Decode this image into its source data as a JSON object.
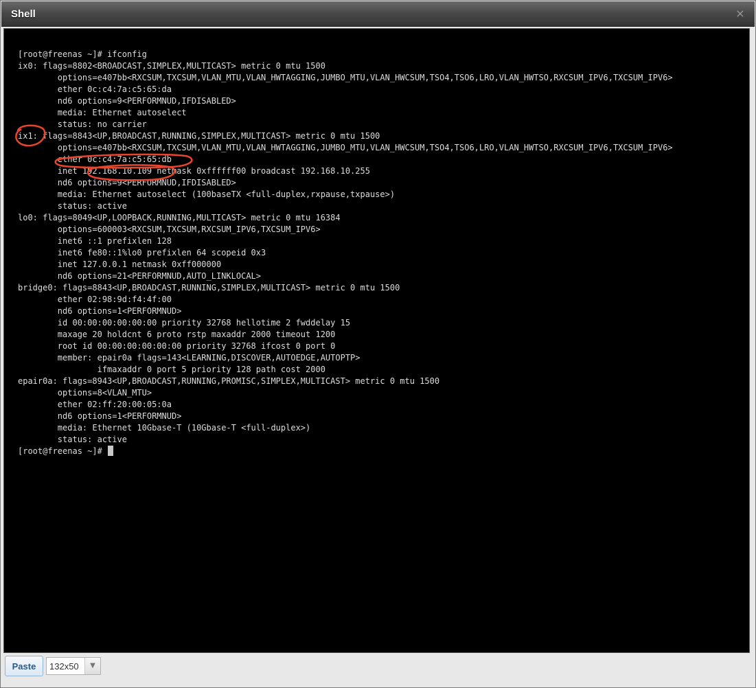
{
  "window": {
    "title": "Shell",
    "close_icon": "×"
  },
  "terminal": {
    "lines": [
      "[root@freenas ~]# ifconfig",
      "ix0: flags=8802<BROADCAST,SIMPLEX,MULTICAST> metric 0 mtu 1500",
      "        options=e407bb<RXCSUM,TXCSUM,VLAN_MTU,VLAN_HWTAGGING,JUMBO_MTU,VLAN_HWCSUM,TSO4,TSO6,LRO,VLAN_HWTSO,RXCSUM_IPV6,TXCSUM_IPV6>",
      "        ether 0c:c4:7a:c5:65:da",
      "        nd6 options=9<PERFORMNUD,IFDISABLED>",
      "        media: Ethernet autoselect",
      "        status: no carrier",
      "ix1: flags=8843<UP,BROADCAST,RUNNING,SIMPLEX,MULTICAST> metric 0 mtu 1500",
      "        options=e407bb<RXCSUM,TXCSUM,VLAN_MTU,VLAN_HWTAGGING,JUMBO_MTU,VLAN_HWCSUM,TSO4,TSO6,LRO,VLAN_HWTSO,RXCSUM_IPV6,TXCSUM_IPV6>",
      "        ether 0c:c4:7a:c5:65:db",
      "        inet 192.168.10.109 netmask 0xffffff00 broadcast 192.168.10.255",
      "        nd6 options=9<PERFORMNUD,IFDISABLED>",
      "        media: Ethernet autoselect (100baseTX <full-duplex,rxpause,txpause>)",
      "        status: active",
      "lo0: flags=8049<UP,LOOPBACK,RUNNING,MULTICAST> metric 0 mtu 16384",
      "        options=600003<RXCSUM,TXCSUM,RXCSUM_IPV6,TXCSUM_IPV6>",
      "        inet6 ::1 prefixlen 128",
      "        inet6 fe80::1%lo0 prefixlen 64 scopeid 0x3",
      "        inet 127.0.0.1 netmask 0xff000000",
      "        nd6 options=21<PERFORMNUD,AUTO_LINKLOCAL>",
      "bridge0: flags=8843<UP,BROADCAST,RUNNING,SIMPLEX,MULTICAST> metric 0 mtu 1500",
      "        ether 02:98:9d:f4:4f:00",
      "        nd6 options=1<PERFORMNUD>",
      "        id 00:00:00:00:00:00 priority 32768 hellotime 2 fwddelay 15",
      "        maxage 20 holdcnt 6 proto rstp maxaddr 2000 timeout 1200",
      "        root id 00:00:00:00:00:00 priority 32768 ifcost 0 port 0",
      "        member: epair0a flags=143<LEARNING,DISCOVER,AUTOEDGE,AUTOPTP>",
      "                ifmaxaddr 0 port 5 priority 128 path cost 2000",
      "epair0a: flags=8943<UP,BROADCAST,RUNNING,PROMISC,SIMPLEX,MULTICAST> metric 0 mtu 1500",
      "        options=8<VLAN_MTU>",
      "        ether 02:ff:20:00:05:0a",
      "        nd6 options=1<PERFORMNUD>",
      "        media: Ethernet 10Gbase-T (10Gbase-T <full-duplex>)",
      "        status: active"
    ],
    "prompt": "[root@freenas ~]# ",
    "annotation_color": "#e8452c"
  },
  "bottom_bar": {
    "paste_label": "Paste",
    "terminal_size": "132x50",
    "dropdown_icon": "chevron-down-icon"
  }
}
